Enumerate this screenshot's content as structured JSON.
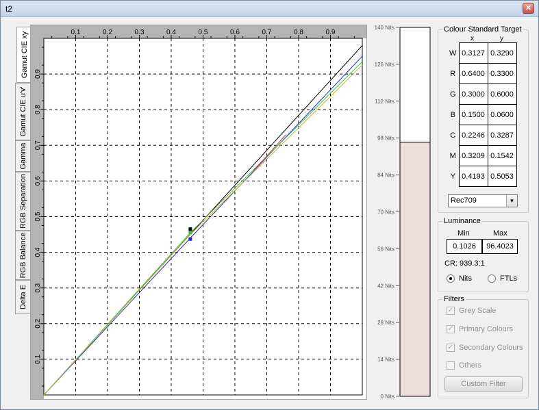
{
  "window": {
    "title": "t2",
    "close_glyph": "✕"
  },
  "tabs": [
    {
      "label": "Gamut CIE xy",
      "active": true
    },
    {
      "label": "Gamut CIE u'v'",
      "active": false
    },
    {
      "label": "Gamma",
      "active": false
    },
    {
      "label": "RGB Separation",
      "active": false
    },
    {
      "label": "RGB Balance",
      "active": false
    },
    {
      "label": "Delta E",
      "active": false
    }
  ],
  "chart_data": {
    "type": "line",
    "x_ticks": [
      "0.1",
      "0.2",
      "0.3",
      "0.4",
      "0.5",
      "0.6",
      "0.7",
      "0.8",
      "0.9"
    ],
    "y_ticks": [
      "0.1",
      "0.2",
      "0.3",
      "0.4",
      "0.5",
      "0.6",
      "0.7",
      "0.8",
      "0.9"
    ],
    "xlim": [
      0,
      1
    ],
    "ylim": [
      0,
      1
    ],
    "grid": true,
    "series": [
      {
        "color": "#000000",
        "points": [
          [
            0,
            0
          ],
          [
            1,
            0.98
          ]
        ]
      },
      {
        "color": "#2a2ad0",
        "points": [
          [
            0,
            0
          ],
          [
            0.46,
            0.44
          ],
          [
            1,
            0.95
          ]
        ]
      },
      {
        "color": "#3cc83c",
        "points": [
          [
            0,
            0
          ],
          [
            0.46,
            0.455
          ],
          [
            1,
            0.935
          ]
        ]
      },
      {
        "color": "#c8b040",
        "points": [
          [
            0,
            0
          ],
          [
            0.46,
            0.45
          ],
          [
            1,
            0.925
          ]
        ]
      },
      {
        "color": "#c04040",
        "points": [
          [
            0.66,
            0.63
          ],
          [
            0.76,
            0.73
          ]
        ]
      }
    ],
    "markers": [
      {
        "x": 0.46,
        "y": 0.465,
        "color": "#000000"
      },
      {
        "x": 0.46,
        "y": 0.455,
        "color": "#3cc83c"
      },
      {
        "x": 0.46,
        "y": 0.437,
        "color": "#2a2ad0"
      }
    ]
  },
  "nits": {
    "ticks": [
      "140 Nits",
      "126 Nits",
      "112 Nits",
      "98 Nits",
      "84 Nits",
      "70 Nits",
      "56 Nits",
      "42 Nits",
      "28 Nits",
      "14 Nits",
      "0 Nits"
    ],
    "max": 140,
    "level": 96.4023,
    "fill_color": "#eddddd"
  },
  "colour_standard": {
    "title": "Colour Standard Target",
    "col_x": "x",
    "col_y": "y",
    "rows": [
      {
        "label": "W",
        "x": "0.3127",
        "y": "0.3290"
      },
      {
        "label": "R",
        "x": "0.6400",
        "y": "0.3300"
      },
      {
        "label": "G",
        "x": "0.3000",
        "y": "0.6000"
      },
      {
        "label": "B",
        "x": "0.1500",
        "y": "0.0600"
      },
      {
        "label": "C",
        "x": "0.2246",
        "y": "0.3287"
      },
      {
        "label": "M",
        "x": "0.3209",
        "y": "0.1542"
      },
      {
        "label": "Y",
        "x": "0.4193",
        "y": "0.5053"
      }
    ],
    "standard": "Rec709",
    "dropdown_glyph": "▼"
  },
  "luminance": {
    "title": "Luminance",
    "min_label": "Min",
    "max_label": "Max",
    "min": "0.1026",
    "max": "96.4023",
    "cr": "CR: 939.3:1",
    "unit_nits": "Nits",
    "unit_ftls": "FTLs",
    "selected_unit": "Nits"
  },
  "filters": {
    "title": "Filters",
    "check_glyph": "✓",
    "items": [
      {
        "label": "Grey Scale",
        "checked": true
      },
      {
        "label": "Primary Colours",
        "checked": true
      },
      {
        "label": "Secondary Colours",
        "checked": true
      },
      {
        "label": "Others",
        "checked": false
      }
    ],
    "custom_button": "Custom Filter"
  }
}
